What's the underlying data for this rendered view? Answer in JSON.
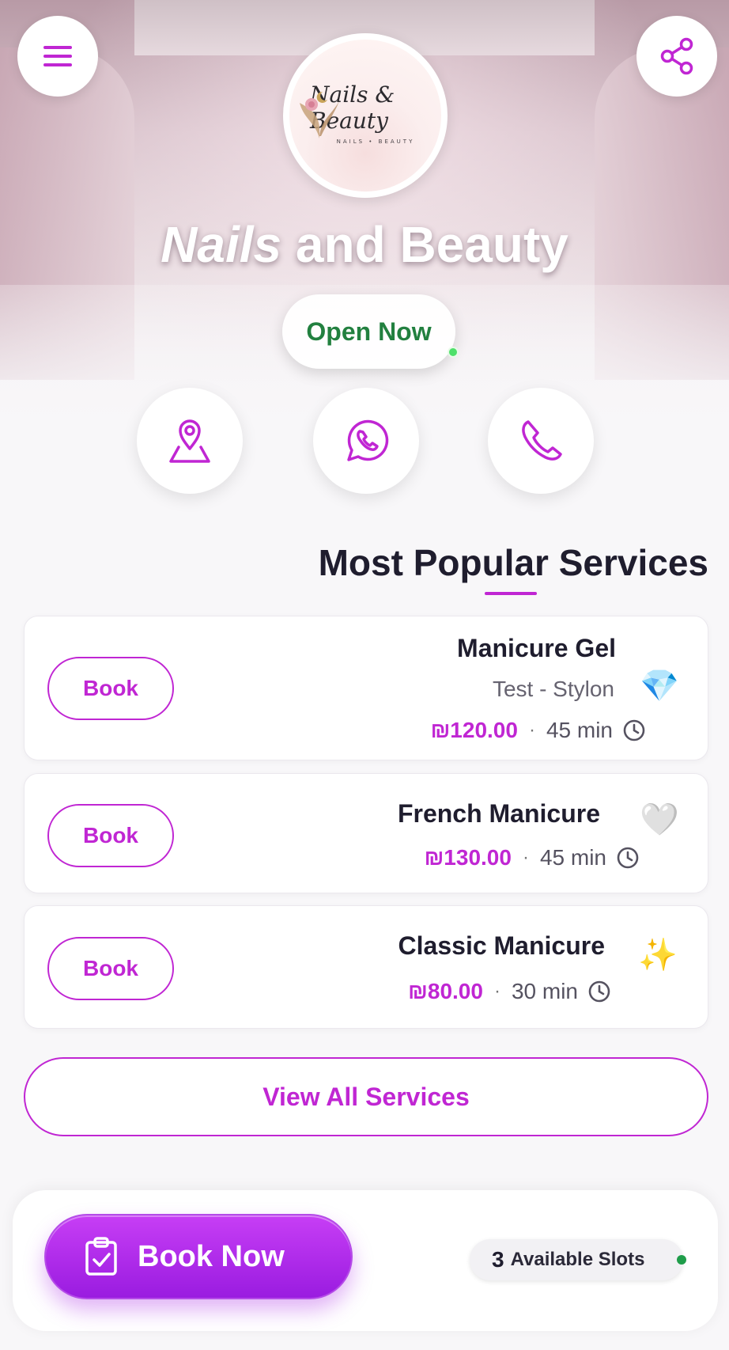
{
  "colors": {
    "accent": "#c026d3",
    "open_green": "#22803f",
    "status_dot": "#1f9d4a"
  },
  "header": {
    "menu_icon": "hamburger-menu-icon",
    "share_icon": "share-icon",
    "logo": {
      "script": "Nails & Beauty",
      "sub": "NAILS • BEAUTY"
    },
    "business_name_part1": "Nails",
    "business_name_part2": " and Beauty",
    "status": "Open Now"
  },
  "actions": [
    {
      "name": "location",
      "icon": "map-pin-icon"
    },
    {
      "name": "whatsapp",
      "icon": "whatsapp-icon"
    },
    {
      "name": "phone",
      "icon": "phone-icon"
    }
  ],
  "services_section": {
    "title": "Most Popular Services",
    "book_label": "Book",
    "items": [
      {
        "name": "Manicure Gel",
        "subtitle": "Test - Stylon",
        "price": "₪120.00",
        "separator": "·",
        "duration": "45 min",
        "emoji": "💎"
      },
      {
        "name": "French Manicure",
        "price": "₪130.00",
        "separator": "·",
        "duration": "45 min",
        "emoji": "🤍"
      },
      {
        "name": "Classic Manicure",
        "price": "₪80.00",
        "separator": "·",
        "duration": "30 min",
        "emoji": "✨"
      }
    ],
    "view_all": "View All Services"
  },
  "bottom_bar": {
    "book_now": "Book Now",
    "slots_count": "3",
    "slots_label": "Available Slots"
  }
}
